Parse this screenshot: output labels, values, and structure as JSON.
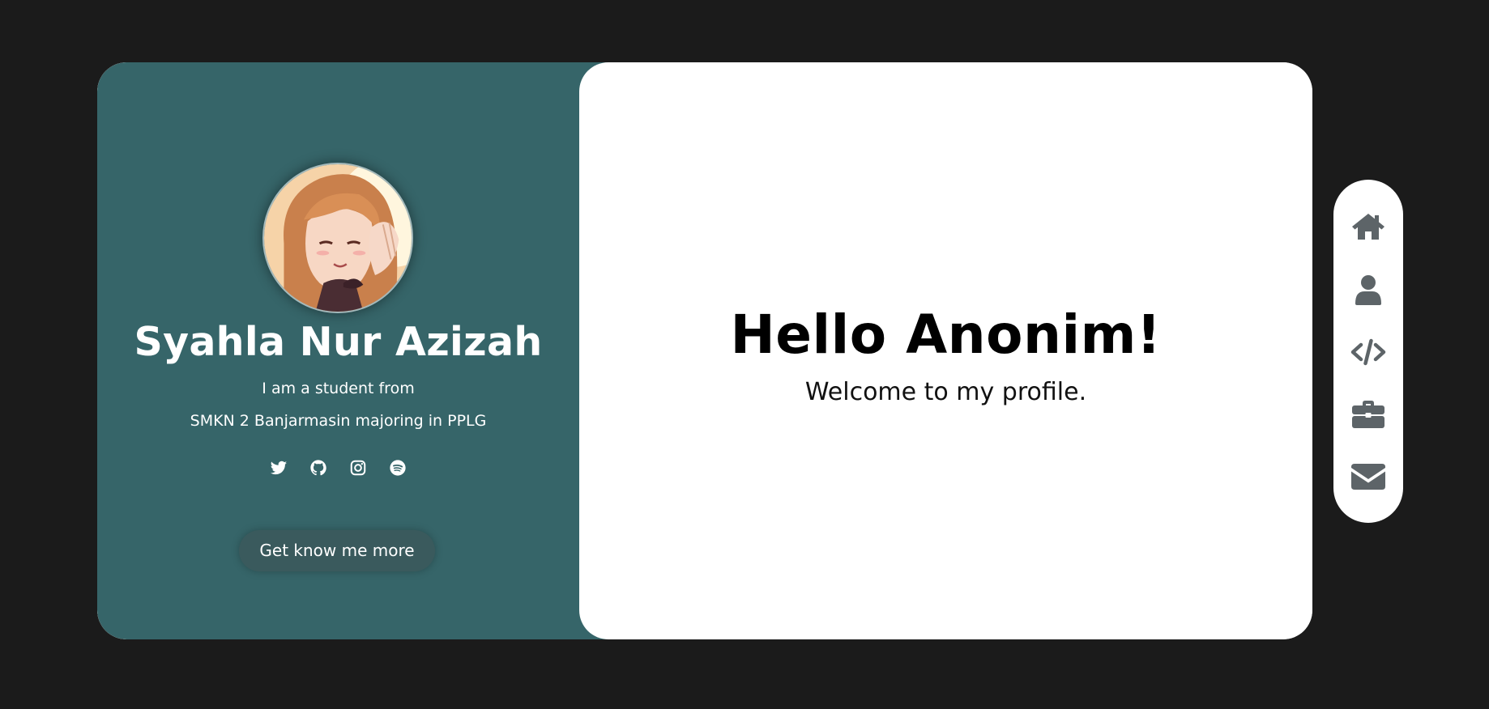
{
  "profile": {
    "name": "Syahla Nur Azizah",
    "bio_line_1": "I am a student from",
    "bio_line_2": "SMKN 2 Banjarmasin majoring in PPLG",
    "cta_label": "Get know me more"
  },
  "main": {
    "greeting": "Hello Anonim!",
    "subtitle": "Welcome to my profile."
  },
  "social_icons": [
    "twitter-icon",
    "github-icon",
    "instagram-icon",
    "spotify-icon"
  ],
  "nav_icons": [
    "home-icon",
    "user-icon",
    "code-icon",
    "briefcase-icon",
    "envelope-icon"
  ],
  "colors": {
    "background": "#1b1b1b",
    "left_panel": "#366569",
    "card": "#ffffff",
    "cta": "#3a5a5d",
    "nav_icon": "#5d6468"
  }
}
